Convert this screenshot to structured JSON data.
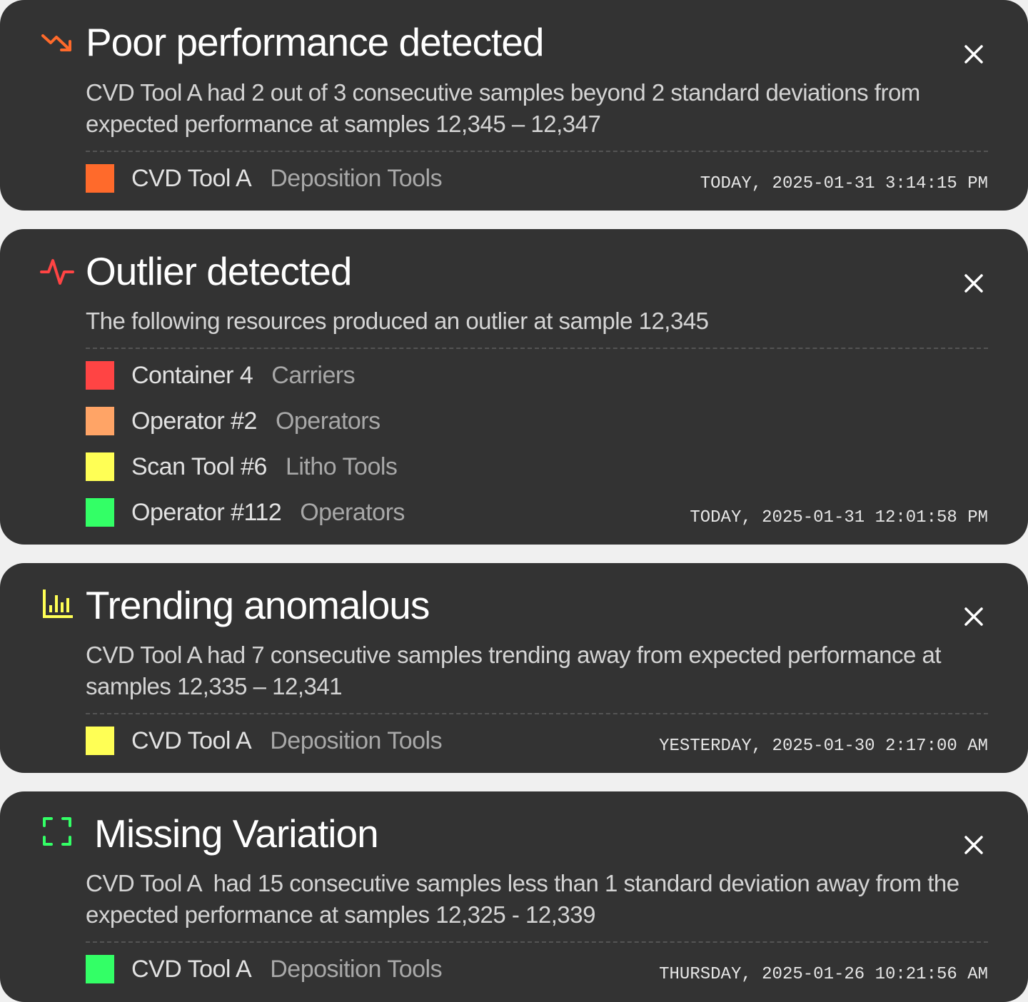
{
  "alerts": [
    {
      "icon": "trending-down-icon",
      "color": "#ff6a2b",
      "title": "Poor performance detected",
      "description": "CVD Tool A had 2 out of 3 consecutive samples beyond 2 standard deviations from expected performance at samples 12,345 – 12,347",
      "resources": [
        {
          "name": "CVD Tool A",
          "group": "Deposition Tools",
          "color": "#ff6a2b"
        }
      ],
      "timestamp": "TODAY, 2025-01-31 3:14:15 PM"
    },
    {
      "icon": "activity-pulse-icon",
      "color": "#ff4444",
      "title": "Outlier detected",
      "description": "The following resources produced an outlier at sample 12,345",
      "resources": [
        {
          "name": "Container 4",
          "group": "Carriers",
          "color": "#ff4444"
        },
        {
          "name": "Operator #2",
          "group": "Operators",
          "color": "#ffa466"
        },
        {
          "name": "Scan Tool #6",
          "group": "Litho Tools",
          "color": "#ffff55"
        },
        {
          "name": "Operator #112",
          "group": "Operators",
          "color": "#33ff66"
        }
      ],
      "timestamp": "TODAY, 2025-01-31 12:01:58 PM"
    },
    {
      "icon": "bar-chart-icon",
      "color": "#ffff55",
      "title": "Trending anomalous",
      "description": "CVD Tool A had 7 consecutive samples trending away from expected performance at samples 12,335 – 12,341",
      "resources": [
        {
          "name": "CVD Tool A",
          "group": "Deposition Tools",
          "color": "#ffff55"
        }
      ],
      "timestamp": "YESTERDAY, 2025-01-30 2:17:00 AM"
    },
    {
      "icon": "focus-frame-icon",
      "color": "#33ff66",
      "title": "Missing Variation",
      "description": "CVD Tool A  had 15 consecutive samples less than 1 standard deviation away from the expected performance at samples 12,325 - 12,339",
      "resources": [
        {
          "name": "CVD Tool A",
          "group": "Deposition Tools",
          "color": "#33ff66"
        }
      ],
      "timestamp": "THURSDAY, 2025-01-26 10:21:56 AM"
    }
  ]
}
